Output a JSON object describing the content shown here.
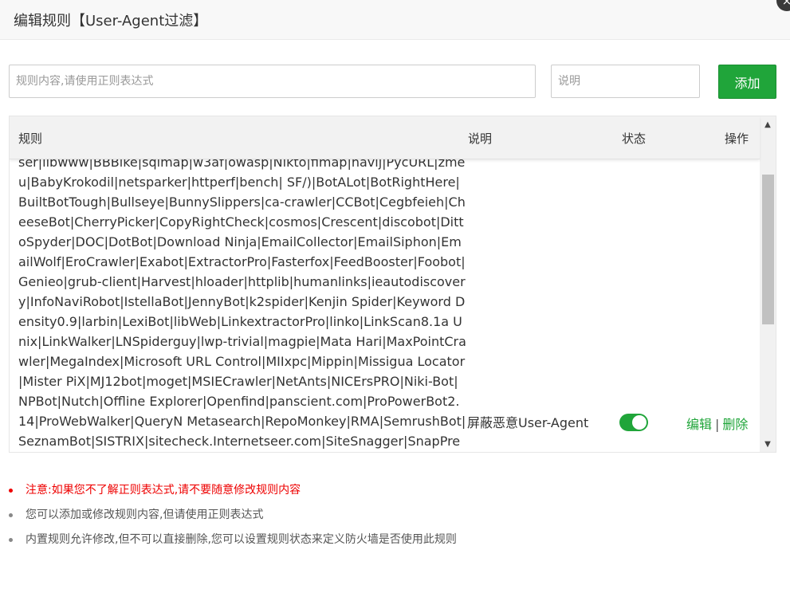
{
  "dialog": {
    "title": "编辑规则【User-Agent过滤】",
    "close_icon": "×"
  },
  "form": {
    "rule_placeholder": "规则内容,请使用正则表达式",
    "rule_value": "",
    "desc_placeholder": "说明",
    "desc_value": "",
    "add_label": "添加"
  },
  "table": {
    "headers": {
      "rule": "规则",
      "desc": "说明",
      "status": "状态",
      "action": "操作"
    },
    "rows": [
      {
        "rule": "(HTTrack|harvest|audit|dirbuster|pangolin|nmap|sqln|-scan|hydra|Parser|libwww|BBBike|sqlmap|w3af|owasp|Nikto|fimap|havij|PycURL|zmeu|BabyKrokodil|netsparker|httperf|bench| SF/)|BotALot|BotRightHere|BuiltBotTough|Bullseye|BunnySlippers|ca-crawler|CCBot|Cegbfeieh|CheeseBot|CherryPicker|CopyRightCheck|cosmos|Crescent|discobot|DittoSpyder|DOC|DotBot|Download Ninja|EmailCollector|EmailSiphon|EmailWolf|EroCrawler|Exabot|ExtractorPro|Fasterfox|FeedBooster|Foobot|Genieo|grub-client|Harvest|hloader|httplib|humanlinks|ieautodiscovery|InfoNaviRobot|IstellaBot|JennyBot|k2spider|Kenjin Spider|Keyword Density0.9|larbin|LexiBot|libWeb|LinkextractorPro|linko|LinkScan8.1a Unix|LinkWalker|LNSpiderguy|lwp-trivial|magpie|Mata Hari|MaxPointCrawler|MegaIndex|Microsoft URL Control|MIIxpc|Mippin|Missigua Locator|Mister PiX|MJ12bot|moget|MSIECrawler|NetAnts|NICErsPRO|Niki-Bot|NPBot|Nutch|Offline Explorer|Openfind|panscient.com|ProPowerBot2.14|ProWebWalker|QueryN Metasearch|RepoMonkey|RMA|SemrushBot|SeznamBot|SISTRIX|sitecheck.Internetseer.com|SiteSnagger|SnapPreviewBot|SpankBot|spanner|spbot|Spinn3r|suzuran|Szukacz1.4|Teleport|Telesoft|The Intraformant|TheNomad|TightTwatBot|Titan|True_Robot|turingos|TurnitinBot|UbiCrawler|UnisterBot|URLy",
        "desc": "屏蔽恶意User-Agent",
        "status_enabled": true,
        "edit_label": "编辑",
        "separator": "|",
        "delete_label": "删除"
      }
    ],
    "scroll_up_icon": "▲",
    "scroll_down_icon": "▼"
  },
  "notes": [
    {
      "text": "注意:如果您不了解正则表达式,请不要随意修改规则内容",
      "color": "#ee0000"
    },
    {
      "text": "您可以添加或修改规则内容,但请使用正则表达式",
      "color": "#555555"
    },
    {
      "text": "内置规则允许修改,但不可以直接删除,您可以设置规则状态来定义防火墙是否使用此规则",
      "color": "#555555"
    }
  ],
  "colors": {
    "accent": "#20a53a",
    "warning": "#ee0000"
  }
}
